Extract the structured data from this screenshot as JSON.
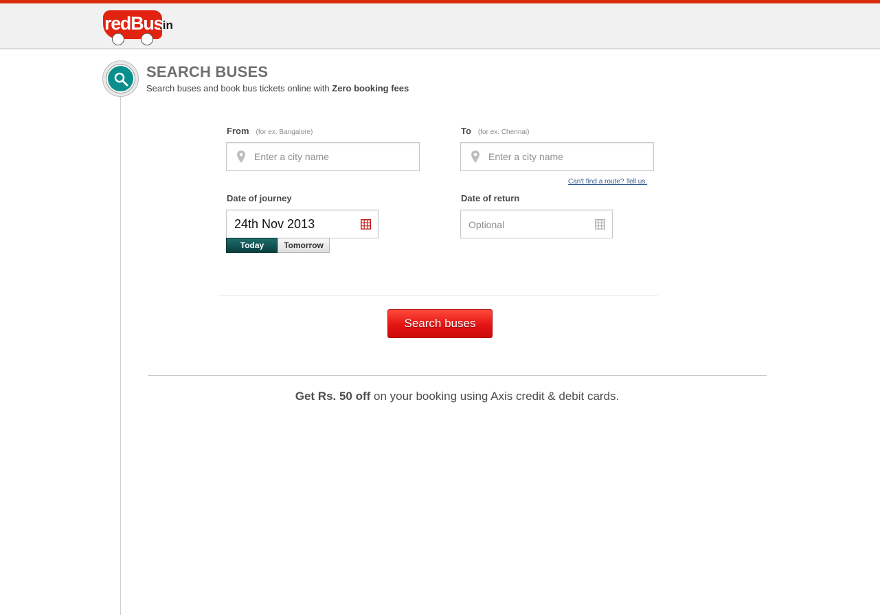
{
  "brand": {
    "logo_text": "redBus",
    "logo_suffix": ".in",
    "color": "#e22310"
  },
  "header": {
    "title": "SEARCH BUSES",
    "subtitle_prefix": "Search buses and book bus tickets online with ",
    "subtitle_bold": "Zero booking fees"
  },
  "form": {
    "from": {
      "label": "From",
      "hint": "(for ex. Bangalore)",
      "placeholder": "Enter a city name",
      "icon": "map-pin-icon"
    },
    "to": {
      "label": "To",
      "hint": "(for ex. Chennai)",
      "placeholder": "Enter a city name",
      "icon": "map-pin-icon"
    },
    "help_link": "Can't find a route? Tell us.",
    "journey": {
      "label": "Date of journey",
      "value": "24th Nov 2013",
      "icon": "calendar-icon"
    },
    "return": {
      "label": "Date of return",
      "placeholder": "Optional",
      "icon": "calendar-icon"
    },
    "quick_dates": {
      "today": "Today",
      "tomorrow": "Tomorrow"
    },
    "submit_label": "Search buses"
  },
  "promo": {
    "bold": "Get Rs. 50 off",
    "rest": " on your booking using Axis credit & debit cards."
  },
  "colors": {
    "accent": "#e22310",
    "teal": "#0a8f8c"
  }
}
